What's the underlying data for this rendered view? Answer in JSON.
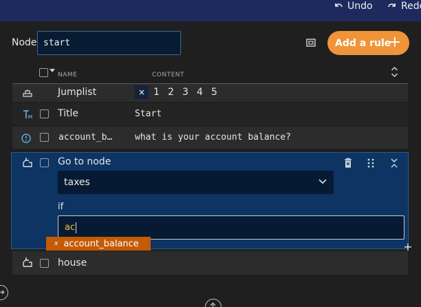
{
  "topbar": {
    "undo_label": "Undo",
    "redo_label": "Redo"
  },
  "node": {
    "label": "Node",
    "value": "start"
  },
  "add_rule_label": "Add a rule",
  "table": {
    "col_name": "NAME",
    "col_content": "CONTENT"
  },
  "rows": {
    "jumplist": {
      "name": "Jumplist",
      "numbers": [
        "1",
        "2",
        "3",
        "4",
        "5"
      ],
      "clear_symbol": "×"
    },
    "title": {
      "name": "Title",
      "content": "Start"
    },
    "account": {
      "name": "account_b…",
      "content": "what is your account balance?"
    },
    "goto": {
      "name": "Go to node",
      "target": "taxes",
      "if_label": "if",
      "if_value": "ac",
      "suggestion": "account_balance",
      "suggestion_symbol": "x"
    },
    "house": {
      "name": "house"
    }
  },
  "colors": {
    "topbar": "#1e2a5e",
    "accent": "#f0943a",
    "selected_panel": "#0d3463",
    "suggestion": "#c45a06"
  }
}
